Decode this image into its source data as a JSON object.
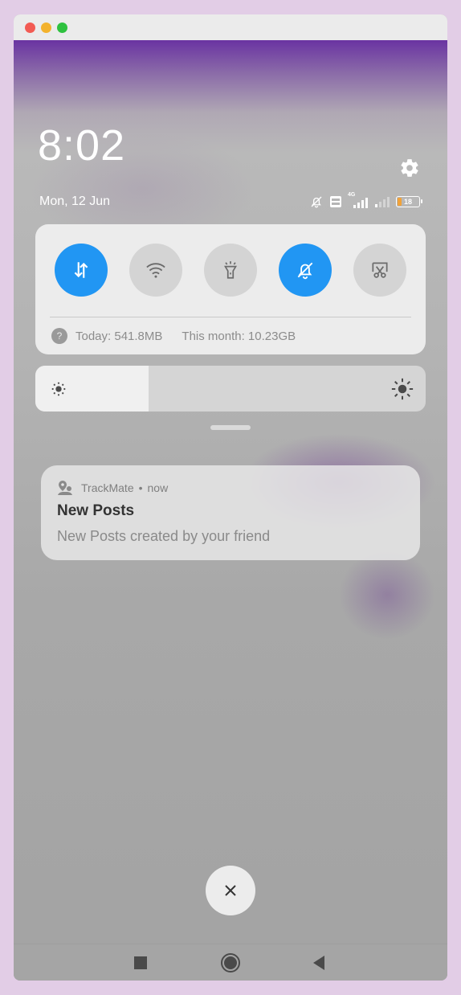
{
  "window": {
    "controls": [
      "close",
      "minimize",
      "maximize"
    ]
  },
  "status": {
    "time": "8:02",
    "date": "Mon, 12 Jun",
    "network_label": "4G",
    "battery_level": "18",
    "icons": [
      "bell-off-icon",
      "volte-icon",
      "signal-4g-icon",
      "signal-icon",
      "battery-icon"
    ]
  },
  "quick_settings": {
    "toggles": [
      {
        "name": "mobile-data",
        "icon": "data-arrows-icon",
        "active": true
      },
      {
        "name": "wifi",
        "icon": "wifi-icon",
        "active": false
      },
      {
        "name": "flashlight",
        "icon": "flashlight-icon",
        "active": false
      },
      {
        "name": "silent",
        "icon": "bell-off-icon",
        "active": true
      },
      {
        "name": "screenshot",
        "icon": "scissors-icon",
        "active": false
      }
    ],
    "data_usage": {
      "today": "Today: 541.8MB",
      "month": "This month: 10.23GB"
    },
    "brightness_level": 0.29
  },
  "notification": {
    "app_name": "TrackMate",
    "separator": "•",
    "time": "now",
    "title": "New Posts",
    "body": "New Posts created by your friend"
  },
  "colors": {
    "accent": "#2196f3",
    "header_purple": "#6a33a2",
    "battery": "#f0a23a"
  },
  "navigation": {
    "buttons": [
      "recents",
      "home",
      "back"
    ]
  }
}
